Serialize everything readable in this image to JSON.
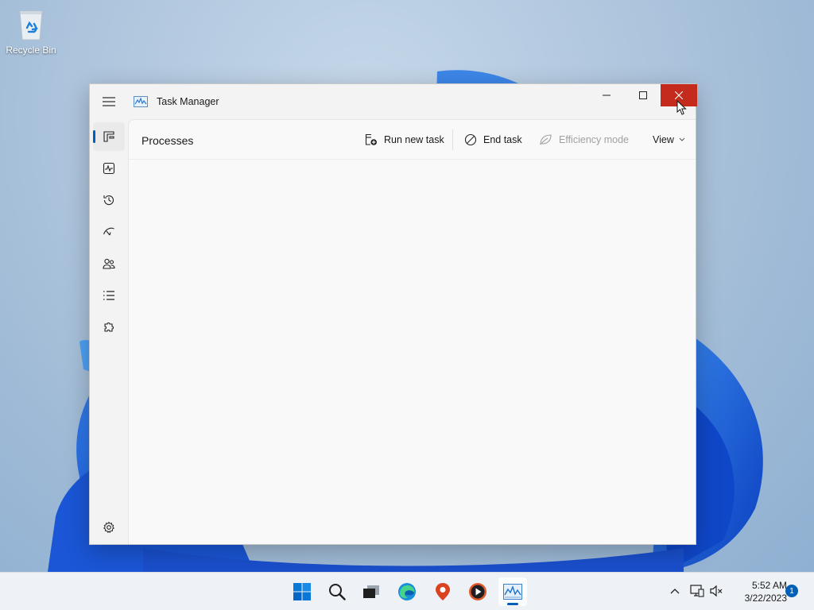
{
  "desktop": {
    "recycle_bin_label": "Recycle Bin"
  },
  "window": {
    "title": "Task Manager",
    "app_icon": "performance-graph-icon",
    "controls": {
      "minimize": "minimize-icon",
      "maximize": "maximize-icon",
      "close": "close-icon"
    },
    "close_color": "#c42b1c"
  },
  "sidebar": {
    "items": [
      {
        "name": "processes",
        "icon": "processes-icon",
        "active": true
      },
      {
        "name": "performance",
        "icon": "performance-icon"
      },
      {
        "name": "app-history",
        "icon": "history-icon"
      },
      {
        "name": "startup-apps",
        "icon": "startup-icon"
      },
      {
        "name": "users",
        "icon": "users-icon"
      },
      {
        "name": "details",
        "icon": "details-list-icon"
      },
      {
        "name": "services",
        "icon": "services-puzzle-icon"
      }
    ],
    "settings_icon": "gear-icon"
  },
  "page": {
    "title": "Processes"
  },
  "commands": {
    "run_new_task": "Run new task",
    "end_task": "End task",
    "efficiency_mode": "Efficiency mode",
    "view": "View"
  },
  "taskbar": {
    "items": [
      {
        "name": "start",
        "icon": "windows-start-icon"
      },
      {
        "name": "search",
        "icon": "search-icon"
      },
      {
        "name": "task-view",
        "icon": "task-view-icon"
      },
      {
        "name": "edge",
        "icon": "edge-browser-icon"
      },
      {
        "name": "maps",
        "icon": "location-pin-icon"
      },
      {
        "name": "media-player",
        "icon": "media-player-icon"
      },
      {
        "name": "task-manager",
        "icon": "task-manager-icon",
        "active": true
      }
    ],
    "tray": {
      "chevron": "chevron-up-icon",
      "network": "network-icon",
      "volume": "volume-muted-icon"
    },
    "time": "5:52 AM",
    "date": "3/22/2023",
    "notification_count": "1"
  },
  "colors": {
    "accent": "#005fb8",
    "window_bg": "#f3f3f3",
    "content_bg": "#f9f9f9"
  }
}
